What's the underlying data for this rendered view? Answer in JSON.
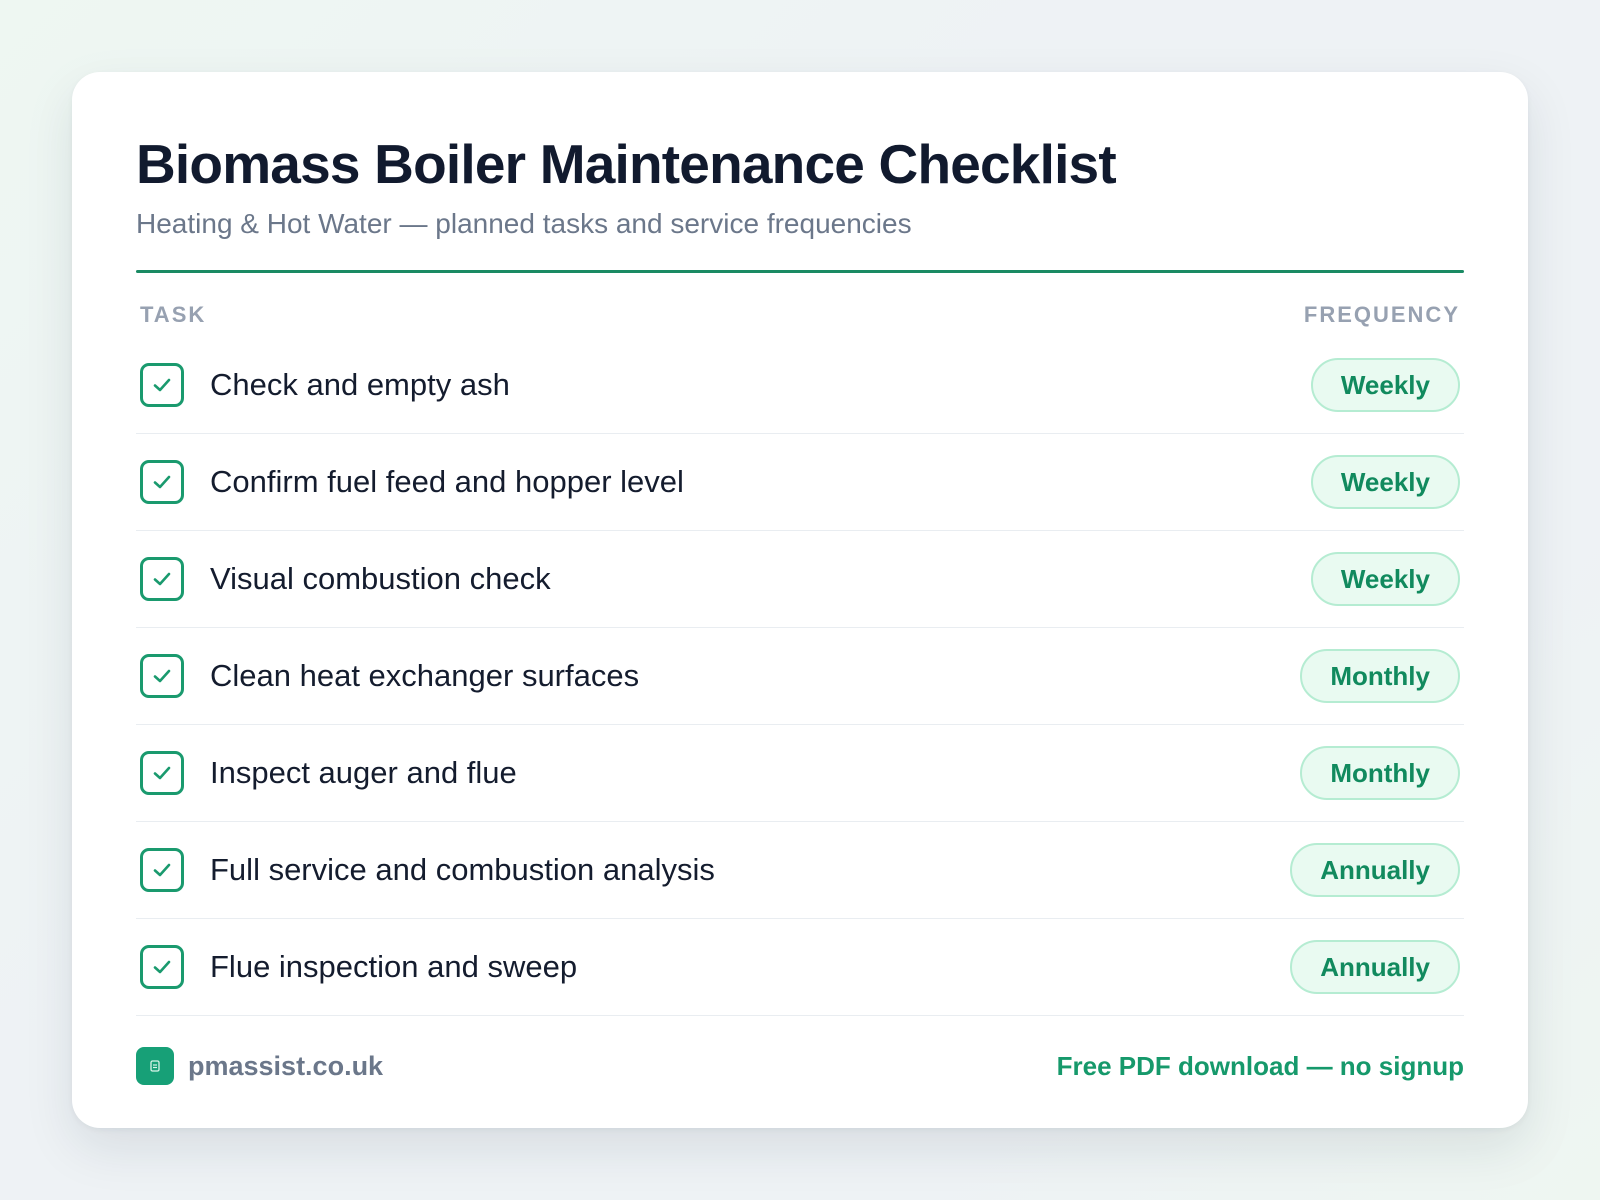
{
  "header": {
    "title": "Biomass Boiler Maintenance Checklist",
    "subtitle": "Heating & Hot Water — planned tasks and service frequencies"
  },
  "columns": {
    "task": "TASK",
    "frequency": "FREQUENCY"
  },
  "tasks": [
    {
      "label": "Check and empty ash",
      "frequency": "Weekly",
      "checked": true
    },
    {
      "label": "Confirm fuel feed and hopper level",
      "frequency": "Weekly",
      "checked": true
    },
    {
      "label": "Visual combustion check",
      "frequency": "Weekly",
      "checked": true
    },
    {
      "label": "Clean heat exchanger surfaces",
      "frequency": "Monthly",
      "checked": true
    },
    {
      "label": "Inspect auger and flue",
      "frequency": "Monthly",
      "checked": true
    },
    {
      "label": "Full service and combustion analysis",
      "frequency": "Annually",
      "checked": true
    },
    {
      "label": "Flue inspection and sweep",
      "frequency": "Annually",
      "checked": true
    }
  ],
  "footer": {
    "site": "pmassist.co.uk",
    "cta": "Free PDF download — no signup",
    "logo_icon": "document-icon"
  },
  "colors": {
    "accent": "#1a8a63",
    "badge_bg": "#e9faf1",
    "badge_border": "#b5ecd2",
    "badge_text": "#118a5e",
    "title": "#111a2e",
    "muted": "#6b778a"
  }
}
